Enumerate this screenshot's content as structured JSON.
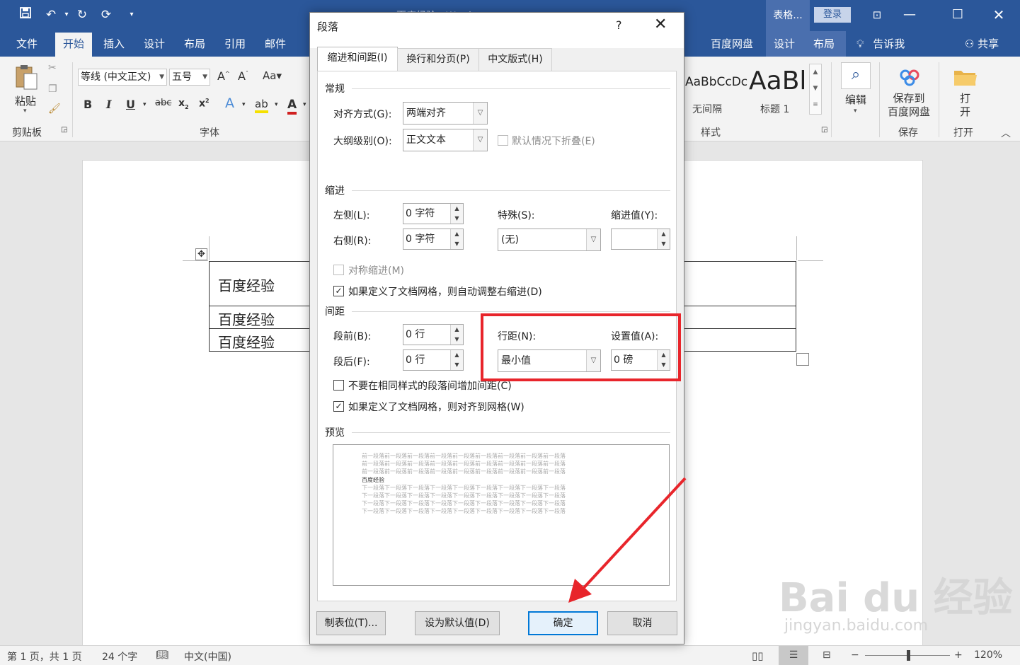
{
  "titlebar": {
    "doc_title": "百度经验 - Word",
    "context_group": "表格...",
    "login": "登录"
  },
  "tabs": [
    "文件",
    "开始",
    "插入",
    "设计",
    "布局",
    "引用",
    "邮件",
    "百度网盘",
    "设计",
    "布局",
    "告诉我",
    "共享"
  ],
  "ribbon": {
    "paste": "粘贴",
    "clipboard": "剪贴板",
    "font_name": "等线 (中文正文)",
    "font_size": "五号",
    "font_group": "字体",
    "style1_preview": "AaBbCcDc",
    "style1_name": "无间隔",
    "style2_preview": "AaBl",
    "style2_name": "标题 1",
    "styles_group": "样式",
    "edit": "编辑",
    "save_to_pan": "保存到\n百度网盘",
    "save_group": "保存",
    "open": "打\n开",
    "open_group": "打开"
  },
  "document": {
    "rows": [
      "百度经验",
      "百度经验",
      "百度经验"
    ]
  },
  "dialog": {
    "title": "段落",
    "help": "?",
    "tabs": [
      "缩进和间距(I)",
      "换行和分页(P)",
      "中文版式(H)"
    ],
    "general": "常规",
    "alignment_label": "对齐方式(G):",
    "alignment_value": "两端对齐",
    "outline_label": "大纲级别(O):",
    "outline_value": "正文文本",
    "collapse_label": "默认情况下折叠(E)",
    "indent": "缩进",
    "left_label": "左侧(L):",
    "left_value": "0 字符",
    "right_label": "右侧(R):",
    "right_value": "0 字符",
    "special_label": "特殊(S):",
    "special_value": "(无)",
    "indent_by_label": "缩进值(Y):",
    "mirror_label": "对称缩进(M)",
    "auto_right_label": "如果定义了文档网格，则自动调整右缩进(D)",
    "spacing": "间距",
    "before_label": "段前(B):",
    "before_value": "0 行",
    "after_label": "段后(F):",
    "after_value": "0 行",
    "line_spacing_label": "行距(N):",
    "line_spacing_value": "最小值",
    "at_label": "设置值(A):",
    "at_value": "0 磅",
    "no_space_label": "不要在相同样式的段落间增加间距(C)",
    "snap_grid_label": "如果定义了文档网格，则对齐到网格(W)",
    "preview": "预览",
    "preview_prev": "前一段落前一段落前一段落前一段落前一段落前一段落前一段落前一段落前一段落",
    "preview_text": "百度经验",
    "preview_next": "下一段落下一段落下一段落下一段落下一段落下一段落下一段落下一段落下一段落",
    "btn_tabs": "制表位(T)...",
    "btn_default": "设为默认值(D)",
    "btn_ok": "确定",
    "btn_cancel": "取消"
  },
  "status": {
    "page": "第 1 页，共 1 页",
    "words": "24 个字",
    "lang": "中文(中国)",
    "zoom": "120%"
  },
  "watermark": {
    "brand": "Bai du 经验",
    "url": "jingyan.baidu.com"
  },
  "colors": {
    "word_blue": "#2b579a",
    "highlight_red": "#e8252b"
  }
}
